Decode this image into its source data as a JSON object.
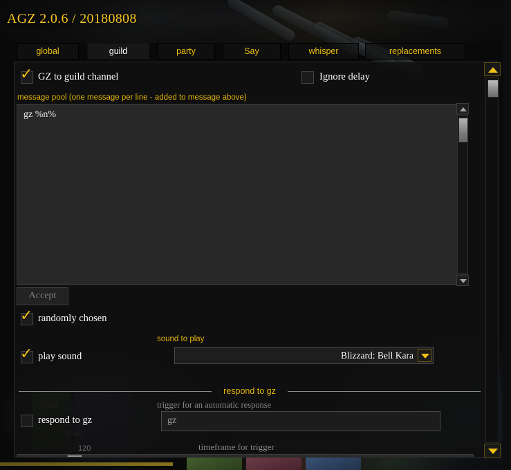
{
  "window": {
    "title": "AGZ 2.0.6 / 20180808",
    "accent_gold": "#f0c016",
    "title_gold": "#f5c520",
    "panel_bg": "#111111",
    "input_bg": "#282828"
  },
  "tabs": [
    {
      "label": "global",
      "active": false
    },
    {
      "label": "guild",
      "active": true
    },
    {
      "label": "party",
      "active": false
    },
    {
      "label": "Say",
      "active": false
    },
    {
      "label": "whisper",
      "active": false
    },
    {
      "label": "replacements",
      "active": false
    }
  ],
  "guild_tab": {
    "gz_channel": {
      "label": "GZ to guild channel",
      "checked": true
    },
    "ignore_delay": {
      "label": "Ignore delay",
      "checked": false
    },
    "message_pool": {
      "label": "message pool (one message per line - added to message above)",
      "value": "gz %n%"
    },
    "accept_button": {
      "label": "Accept",
      "enabled": false
    },
    "randomly_chosen": {
      "label": "randomly chosen",
      "checked": true
    },
    "play_sound": {
      "label": "play sound",
      "checked": true
    },
    "sound_to_play": {
      "label": "sound to play",
      "selected": "Blizzard: Bell Kara",
      "chevron": "chevron-down-icon"
    },
    "respond_section": {
      "divider_label": "respond to gz",
      "respond_checkbox": {
        "label": "respond to gz",
        "checked": false
      },
      "trigger": {
        "label": "trigger for an automatic response",
        "value": "gz"
      },
      "timeframe": {
        "label": "timeframe for trigger",
        "value": "120"
      }
    }
  },
  "scrollbars": {
    "panel": {
      "up_icon": "triangle-up-icon",
      "down_icon": "triangle-down-icon"
    },
    "textarea": {
      "up_icon": "triangle-up-icon",
      "down_icon": "triangle-down-icon"
    }
  },
  "background": {
    "stat_top": "3.4m",
    "stat_bottom": "2.4K"
  }
}
